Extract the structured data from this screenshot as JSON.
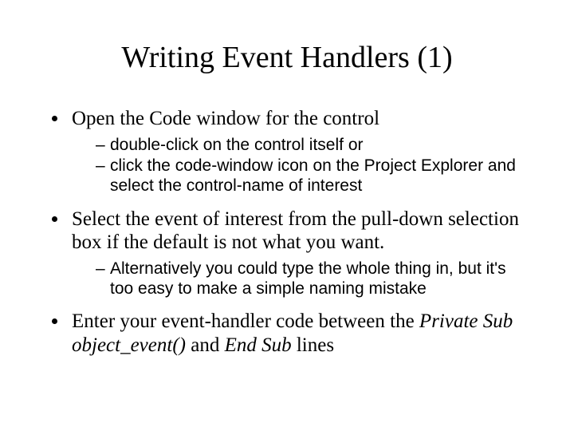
{
  "title": "Writing Event Handlers (1)",
  "bullets": [
    {
      "text": "Open the Code window for the control",
      "sub": [
        "double-click on the control itself or",
        "click the code-window icon on the Project Explorer and select the control-name of interest"
      ]
    },
    {
      "text": "Select the event of interest from the pull-down selection box if the default is not what you want.",
      "sub": [
        "Alternatively you could type the whole thing in, but it's too easy to make a simple naming mistake"
      ]
    },
    {
      "text_pre": "Enter your event-handler code between the ",
      "italic1": "Private Sub object_event()",
      "text_mid": " and ",
      "italic2": "End Sub",
      "text_post": " lines",
      "sub": []
    }
  ]
}
